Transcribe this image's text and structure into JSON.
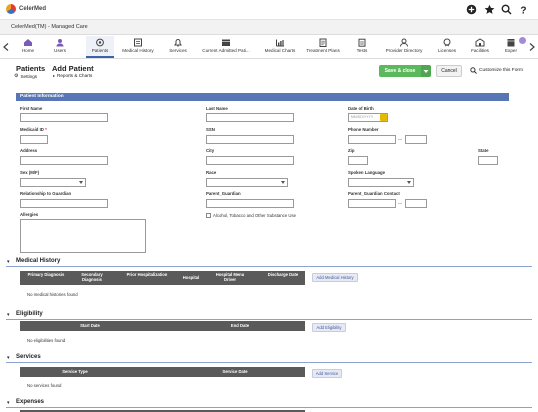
{
  "app": {
    "brand": "CelerMed",
    "subtitle": "CelerMed(TM) - Managed Care"
  },
  "nav": {
    "items": [
      {
        "label": "Home",
        "icon": "home-icon"
      },
      {
        "label": "Users",
        "icon": "users-icon"
      },
      {
        "label": "Patients",
        "icon": "patients-icon"
      },
      {
        "label": "Medical History",
        "icon": "medical-history-icon"
      },
      {
        "label": "Services",
        "icon": "bell-icon"
      },
      {
        "label": "Current Admitted Pati...",
        "icon": "admitted-icon"
      },
      {
        "label": "Medical Charts",
        "icon": "chart-icon"
      },
      {
        "label": "Treatment Plans",
        "icon": "treatment-icon"
      },
      {
        "label": "Tests",
        "icon": "tests-icon"
      },
      {
        "label": "Provider Directory",
        "icon": "directory-icon"
      },
      {
        "label": "Licenses",
        "icon": "licenses-icon"
      },
      {
        "label": "Facilities",
        "icon": "facilities-icon"
      },
      {
        "label": "Exper",
        "icon": "expenses-icon"
      }
    ]
  },
  "header": {
    "section": "Patients",
    "title": "Add Patient",
    "settings": "Settings",
    "reports": "Reports & Charts",
    "save_close": "Save & close",
    "cancel": "Cancel",
    "customize": "Customize this Form"
  },
  "patient_info": {
    "heading": "Patient Information",
    "first_name": "First Name",
    "last_name": "Last Name",
    "dob": "Date of Birth",
    "dob_placeholder": "MM/DD/YYYY",
    "medicaid": "Medicaid ID",
    "ssn": "SSN",
    "phone": "Phone Number",
    "dash": "—",
    "address": "Address",
    "city": "City",
    "zip": "Zip",
    "state": "State",
    "sex": "Sex (M/F)",
    "race": "Race",
    "language": "Spoken Language",
    "relationship": "Relationship to Guardian",
    "parent_guardian": "Parent_Guardian",
    "parent_contact": "Parent_Guardian Contact",
    "allergies": "Allergies",
    "alcohol": "Alcohol, Tobacco and Other Substance Use"
  },
  "medical_history": {
    "title": "Medical History",
    "columns": [
      "Primary Diagnosis",
      "Secondary Diagnosis",
      "Prior Hospitalization",
      "Hospital",
      "Hospital Menu Driver",
      "Discharge Date"
    ],
    "empty": "No medical histories found",
    "add": "Add Medical History"
  },
  "eligibility": {
    "title": "Eligibility",
    "columns": [
      "Start Date",
      "End Date"
    ],
    "empty": "No eligibilities found",
    "add": "Add Eligibility"
  },
  "services": {
    "title": "Services",
    "columns": [
      "Service Type",
      "Service Date"
    ],
    "empty": "No services found",
    "add": "Add Service"
  },
  "expenses": {
    "title": "Expenses"
  },
  "colors": {
    "accent": "#3d63a8",
    "save": "#5cb85c",
    "table_head": "#5a5a5a"
  }
}
